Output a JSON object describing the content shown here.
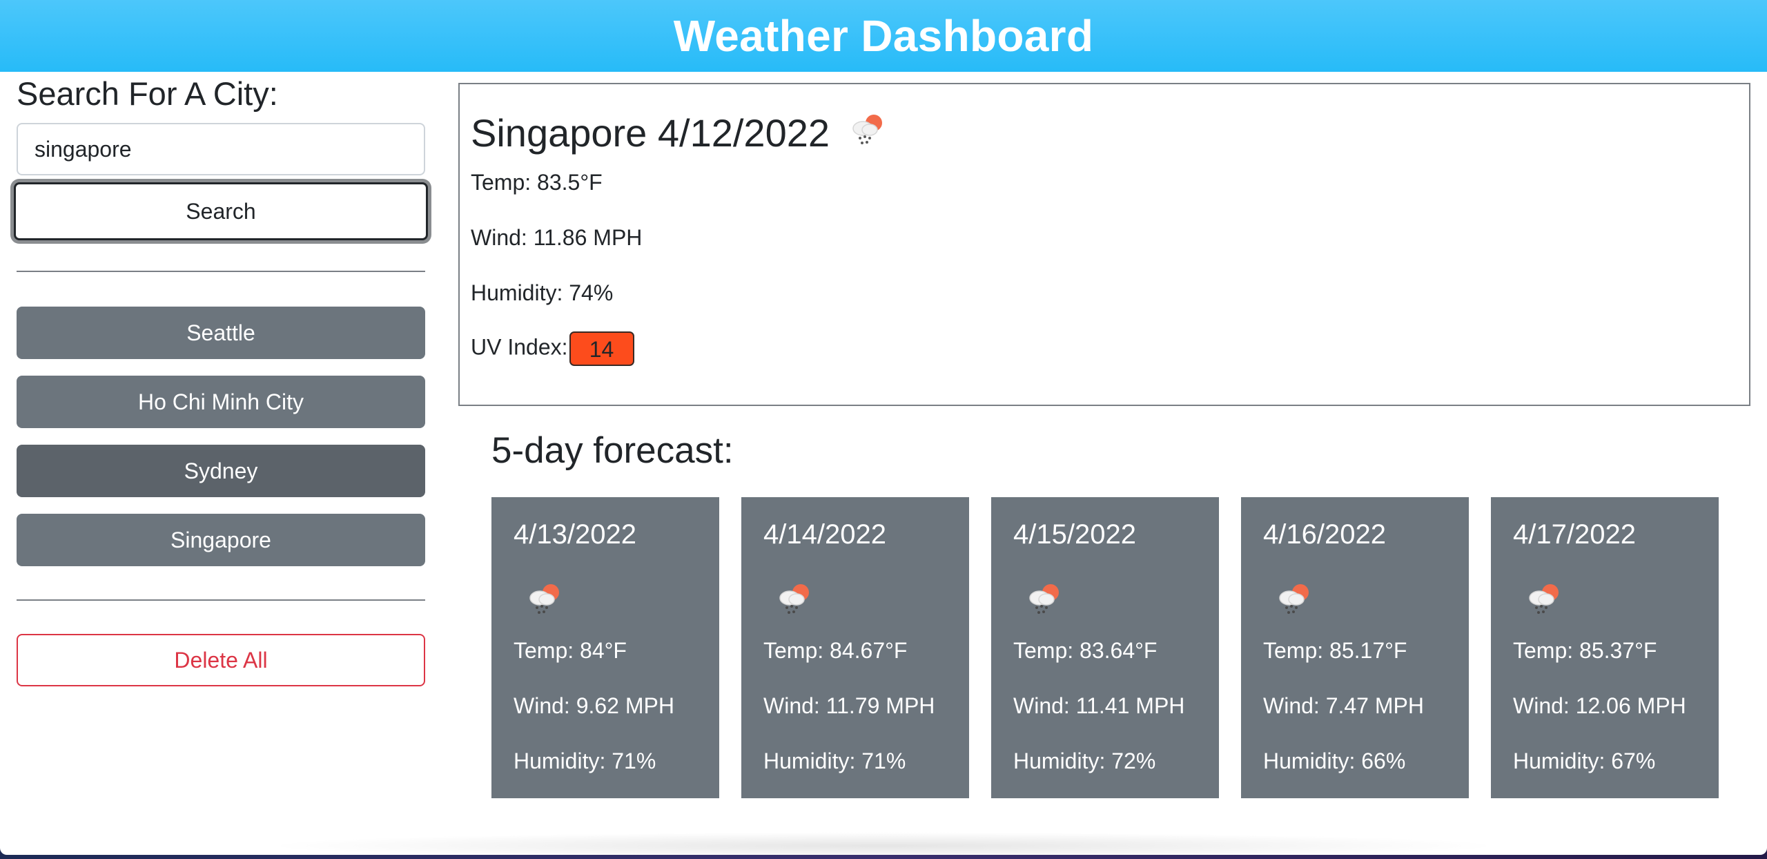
{
  "app": {
    "title": "Weather Dashboard"
  },
  "search": {
    "heading": "Search For A City:",
    "input_value": "singapore",
    "button_label": "Search"
  },
  "history": [
    {
      "label": "Seattle"
    },
    {
      "label": "Ho Chi Minh City"
    },
    {
      "label": "Sydney"
    },
    {
      "label": "Singapore"
    }
  ],
  "delete_label": "Delete All",
  "current": {
    "title": "Singapore 4/12/2022",
    "icon": "cloud-rain-sun-icon",
    "temp": "Temp: 83.5°F",
    "wind": "Wind: 11.86 MPH",
    "humidity": "Humidity: 74%",
    "uv_label": "UV Index:",
    "uv_value": "14",
    "uv_color": "#fd4c1c"
  },
  "forecast": {
    "heading": "5-day forecast:",
    "days": [
      {
        "date": "4/13/2022",
        "icon": "cloud-rain-sun-icon",
        "temp": "Temp: 84°F",
        "wind": "Wind: 9.62 MPH",
        "humidity": "Humidity: 71%"
      },
      {
        "date": "4/14/2022",
        "icon": "cloud-rain-sun-icon",
        "temp": "Temp: 84.67°F",
        "wind": "Wind: 11.79 MPH",
        "humidity": "Humidity: 71%"
      },
      {
        "date": "4/15/2022",
        "icon": "cloud-rain-sun-icon",
        "temp": "Temp: 83.64°F",
        "wind": "Wind: 11.41 MPH",
        "humidity": "Humidity: 72%"
      },
      {
        "date": "4/16/2022",
        "icon": "cloud-rain-sun-icon",
        "temp": "Temp: 85.17°F",
        "wind": "Wind: 7.47 MPH",
        "humidity": "Humidity: 66%"
      },
      {
        "date": "4/17/2022",
        "icon": "cloud-rain-sun-icon",
        "temp": "Temp: 85.37°F",
        "wind": "Wind: 12.06 MPH",
        "humidity": "Humidity: 67%"
      }
    ]
  },
  "colors": {
    "header": "#27bbf8",
    "card": "#6c757d",
    "danger": "#dc3545"
  }
}
